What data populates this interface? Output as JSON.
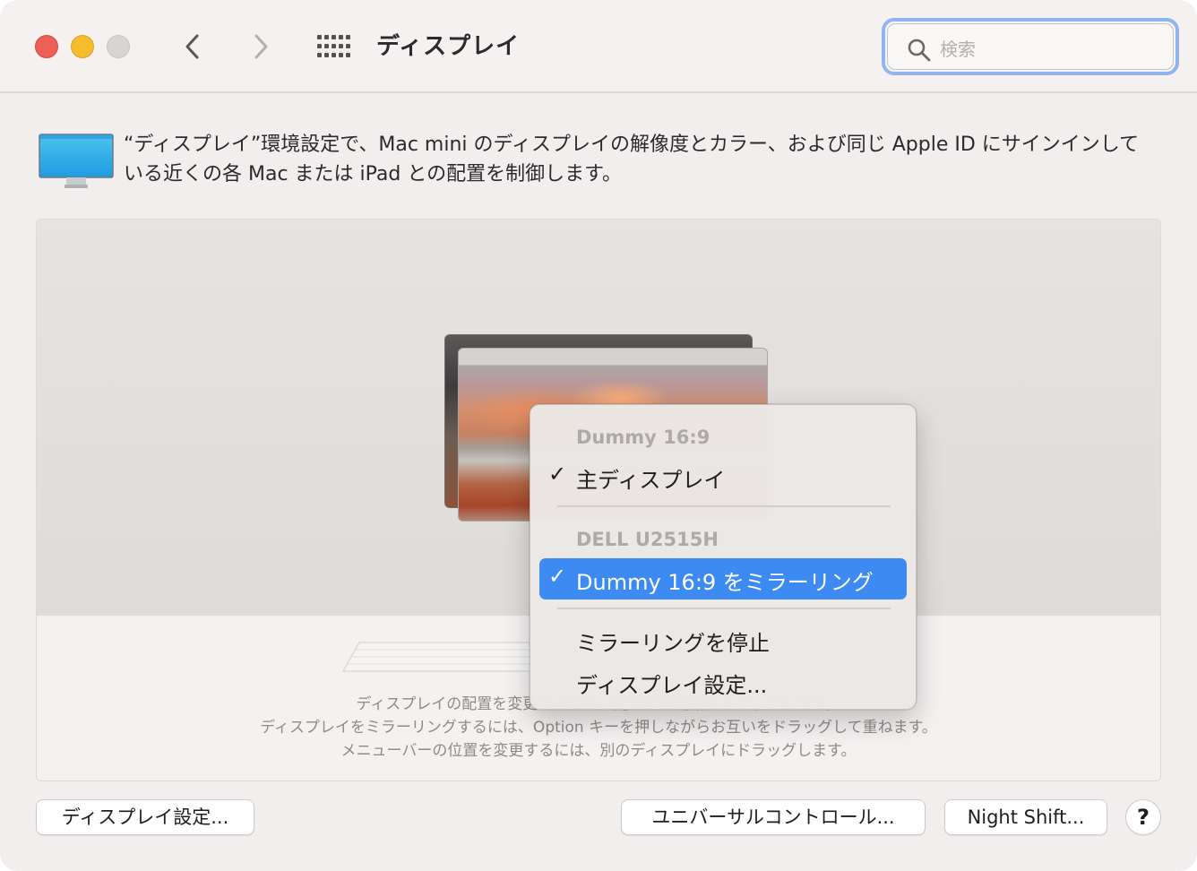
{
  "window": {
    "title": "ディスプレイ"
  },
  "search": {
    "placeholder": "検索",
    "value": ""
  },
  "description": "“ディスプレイ”環境設定で、Mac mini のディスプレイの解像度とカラー、および同じ Apple ID にサインインしている近くの各 Mac または iPad との配置を制御します。",
  "arrangement": {
    "hint_lines": [
      "ディスプレイの配置を変更するには、配置する場所にドラッグします。",
      "ディスプレイをミラーリングするには、Option キーを押しながらお互いをドラッグして重ねます。",
      "メニューバーの位置を変更するには、別のディスプレイにドラッグします。"
    ]
  },
  "context_menu": {
    "section1_header": "Dummy 16:9",
    "primary_display": "主ディスプレイ",
    "section2_header": "DELL U2515H",
    "mirror_item": "Dummy 16:9 をミラーリング",
    "stop_mirroring": "ミラーリングを停止",
    "display_settings": "ディスプレイ設定...",
    "check_mark": "✓"
  },
  "buttons": {
    "display_settings": "ディスプレイ設定...",
    "universal_control": "ユニバーサルコントロール...",
    "night_shift": "Night Shift...",
    "help": "?"
  },
  "colors": {
    "accent": "#3d8bf2",
    "close": "#ed5f57",
    "minimize": "#f5bd2e",
    "search_focus_ring": "#8fb4ee"
  },
  "icons": {
    "back": "chevron-left-icon",
    "forward": "chevron-right-icon",
    "show_all": "grid-icon",
    "search": "magnifier-icon",
    "monitor": "display-icon"
  }
}
